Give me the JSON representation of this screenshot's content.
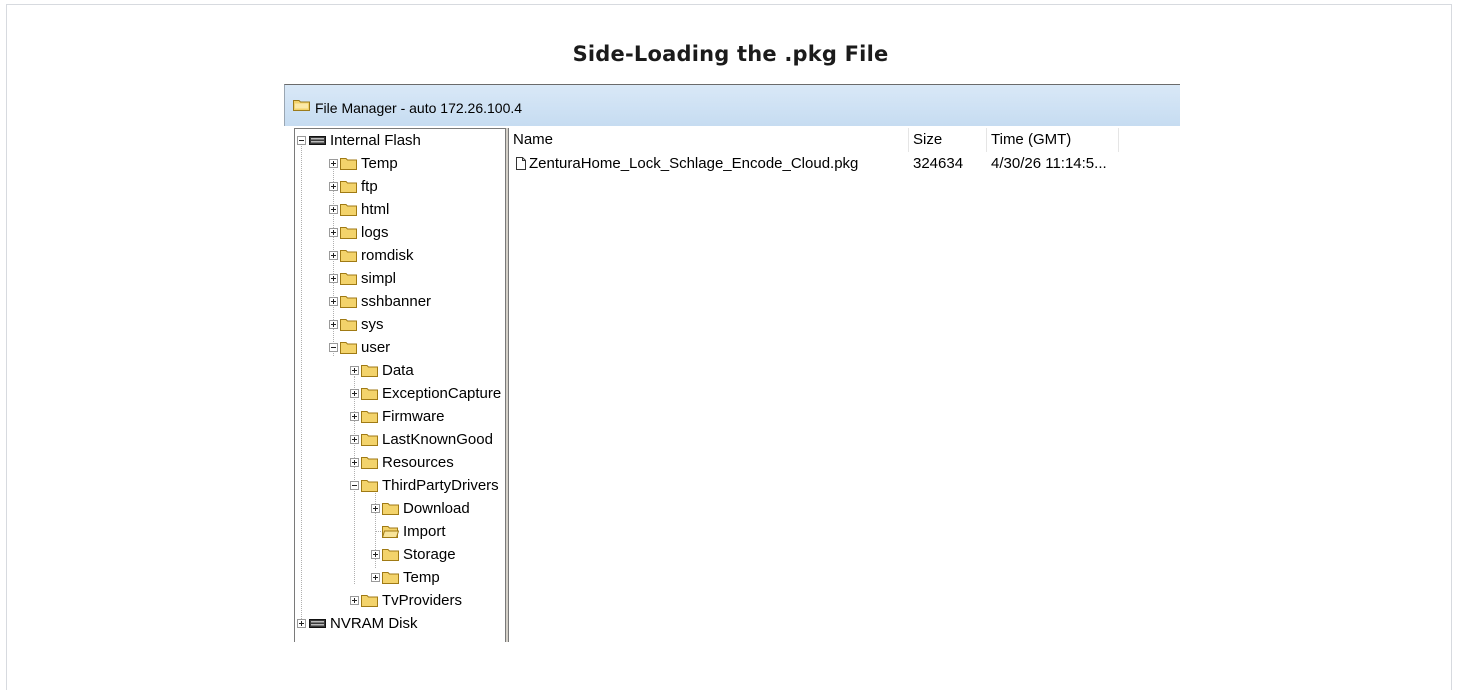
{
  "slide": {
    "title": "Side-Loading the .pkg File"
  },
  "window": {
    "title": "File Manager - auto 172.26.100.4",
    "icon": "folder-icon"
  },
  "tree": {
    "root1": "Internal Flash",
    "root1_children": [
      "Temp",
      "ftp",
      "html",
      "logs",
      "romdisk",
      "simpl",
      "sshbanner",
      "sys"
    ],
    "user": "user",
    "user_children": [
      "Data",
      "ExceptionCapture",
      "Firmware",
      "LastKnownGood",
      "Resources"
    ],
    "thirdparty": "ThirdPartyDrivers",
    "thirdparty_children": [
      "Download",
      "Import",
      "Storage",
      "Temp"
    ],
    "tvproviders": "TvProviders",
    "root2": "NVRAM Disk",
    "selected": "Import"
  },
  "list": {
    "columns": {
      "name": "Name",
      "size": "Size",
      "time": "Time (GMT)"
    },
    "rows": [
      {
        "name": "ZenturaHome_Lock_Schlage_Encode_Cloud.pkg",
        "size": "324634",
        "time": "4/30/26 11:14:5..."
      }
    ]
  },
  "colors": {
    "titlebar": "#c6dcf1",
    "folder": "#f3d36b",
    "frame_border": "#d7dadf"
  }
}
